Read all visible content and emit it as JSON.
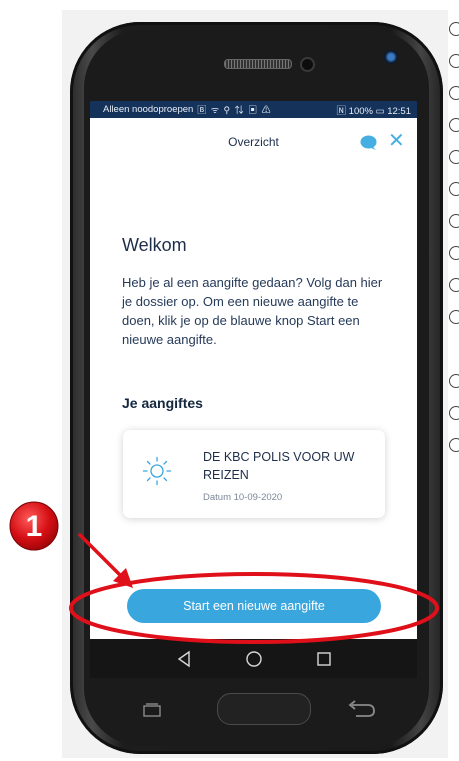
{
  "status_bar": {
    "left_text": "Alleen noodoproepen",
    "icons": "🄱 ᯤ ⚲ ⇅ ▣ ⚠",
    "right_text": "🄽 100% ▭ 12:51"
  },
  "header": {
    "title": "Overzicht",
    "chat_icon": "chat-bubble-icon",
    "close_icon": "close-icon",
    "accent_color": "#45aee3"
  },
  "welcome": {
    "title": "Welkom",
    "body": "Heb je al een aangifte gedaan? Volg dan hier je dossier op. Om een nieuwe aangifte te doen, klik je op de blauwe knop Start een nieuwe aangifte."
  },
  "claims": {
    "section_title": "Je aangiftes",
    "items": [
      {
        "icon": "sun-icon",
        "title": "DE KBC POLIS VOOR UW REIZEN",
        "date": "Datum 10-09-2020"
      }
    ]
  },
  "actions": {
    "start_button": "Start een nieuwe aangifte",
    "button_color": "#3aa6de"
  },
  "annotation": {
    "step_number": "1",
    "highlight_color": "#e0101a"
  },
  "android_nav": {
    "icons": [
      "back-triangle-icon",
      "home-circle-icon",
      "recents-square-icon"
    ]
  }
}
